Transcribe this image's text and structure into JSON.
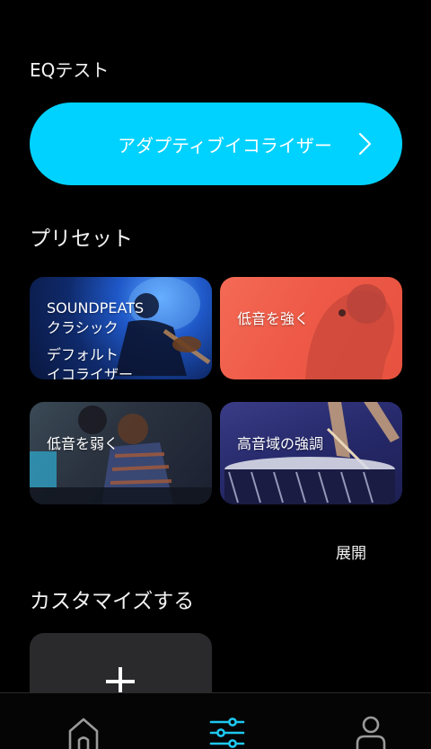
{
  "eq_test": {
    "title": "EQテスト"
  },
  "adaptive": {
    "label": "アダプティブイコライザー",
    "color": "#00d2ff"
  },
  "presets": {
    "title": "プリセット",
    "items": [
      {
        "lines": [
          "SOUNDPEATS",
          "クラシック"
        ],
        "sub_lines": [
          "デフォルト",
          "イコライザー"
        ]
      },
      {
        "lines": [
          "低音を強く"
        ]
      },
      {
        "lines": [
          "低音を弱く"
        ]
      },
      {
        "lines": [
          "高音域の強調"
        ]
      }
    ],
    "expand_label": "展開"
  },
  "custom": {
    "title": "カスタマイズする"
  },
  "tabbar": {
    "active": "eq",
    "accent": "#1ec8f0",
    "tabs": [
      {
        "name": "home",
        "icon": "home-icon"
      },
      {
        "name": "eq",
        "icon": "equalizer-sliders-icon"
      },
      {
        "name": "profile",
        "icon": "person-icon"
      }
    ]
  }
}
